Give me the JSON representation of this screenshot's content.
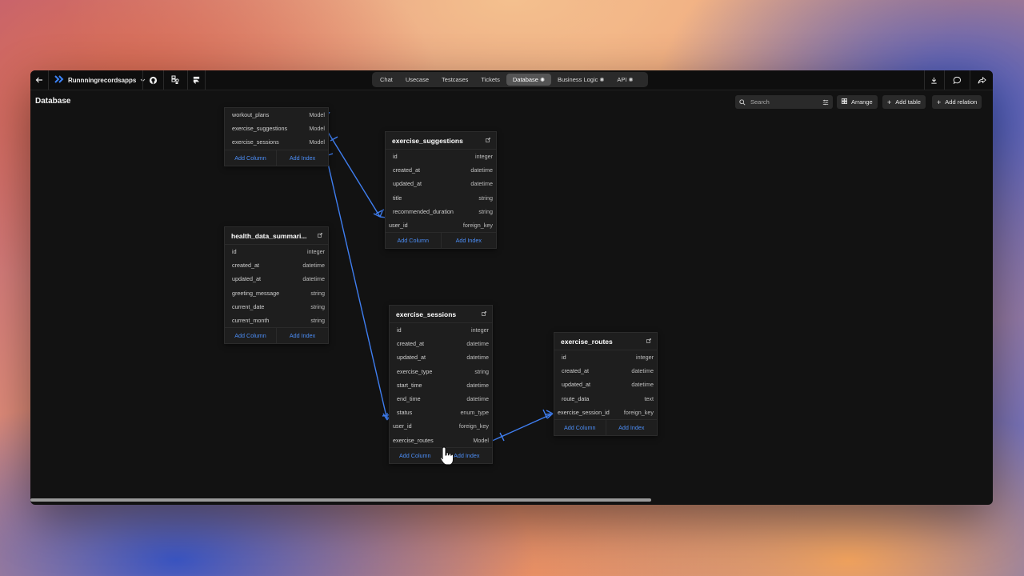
{
  "toolbar": {
    "project_name": "Runnningrecordsapps",
    "tabs": [
      {
        "label": "Chat"
      },
      {
        "label": "Usecase"
      },
      {
        "label": "Testcases"
      },
      {
        "label": "Tickets"
      },
      {
        "label": "Database",
        "active": true,
        "icon": "sparkle-icon"
      },
      {
        "label": "Business Logic",
        "icon": "sparkle-icon"
      },
      {
        "label": "API",
        "icon": "sparkle-icon"
      }
    ],
    "icons": [
      "back-arrow-icon",
      "logo-icon",
      "chevron-down-icon",
      "github-icon",
      "figma-icon",
      "framer-icon",
      "download-icon",
      "comment-icon",
      "share-icon"
    ]
  },
  "subbar": {
    "title": "Database",
    "search_placeholder": "Search",
    "arrange_label": "Arrange",
    "add_table_label": "Add table",
    "add_relation_label": "Add relation"
  },
  "tables": {
    "partial": {
      "rows": [
        {
          "name": "workout_plans",
          "type": "Model"
        },
        {
          "name": "exercise_suggestions",
          "type": "Model"
        },
        {
          "name": "exercise_sessions",
          "type": "Model"
        }
      ],
      "add_column": "Add Column",
      "add_index": "Add Index"
    },
    "exercise_suggestions": {
      "name": "exercise_suggestions",
      "rows": [
        {
          "name": "id",
          "type": "integer"
        },
        {
          "name": "created_at",
          "type": "datetime"
        },
        {
          "name": "updated_at",
          "type": "datetime"
        },
        {
          "name": "title",
          "type": "string"
        },
        {
          "name": "recommended_duration",
          "type": "string"
        },
        {
          "name": "user_id",
          "type": "foreign_key"
        }
      ],
      "add_column": "Add Column",
      "add_index": "Add Index"
    },
    "health_data": {
      "name": "health_data_summari...",
      "rows": [
        {
          "name": "id",
          "type": "integer"
        },
        {
          "name": "created_at",
          "type": "datetime"
        },
        {
          "name": "updated_at",
          "type": "datetime"
        },
        {
          "name": "greeting_message",
          "type": "string"
        },
        {
          "name": "current_date",
          "type": "string"
        },
        {
          "name": "current_month",
          "type": "string"
        }
      ],
      "add_column": "Add Column",
      "add_index": "Add Index"
    },
    "exercise_sessions": {
      "name": "exercise_sessions",
      "rows": [
        {
          "name": "id",
          "type": "integer"
        },
        {
          "name": "created_at",
          "type": "datetime"
        },
        {
          "name": "updated_at",
          "type": "datetime"
        },
        {
          "name": "exercise_type",
          "type": "string"
        },
        {
          "name": "start_time",
          "type": "datetime"
        },
        {
          "name": "end_time",
          "type": "datetime"
        },
        {
          "name": "status",
          "type": "enum_type"
        },
        {
          "name": "user_id",
          "type": "foreign_key"
        },
        {
          "name": "exercise_routes",
          "type": "Model"
        }
      ],
      "add_column": "Add Column",
      "add_index": "Add Index"
    },
    "exercise_routes": {
      "name": "exercise_routes",
      "rows": [
        {
          "name": "id",
          "type": "integer"
        },
        {
          "name": "created_at",
          "type": "datetime"
        },
        {
          "name": "updated_at",
          "type": "datetime"
        },
        {
          "name": "route_data",
          "type": "text"
        },
        {
          "name": "exercise_session_id",
          "type": "foreign_key"
        }
      ],
      "add_column": "Add Column",
      "add_index": "Add Index"
    }
  },
  "colors": {
    "accent_blue": "#4c8ef7",
    "relation_line": "#3f7ef0",
    "window_bg": "#121212",
    "card_bg": "#1e1e1e"
  }
}
